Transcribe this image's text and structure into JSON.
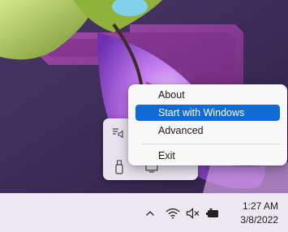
{
  "context_menu": {
    "items": [
      {
        "label": "About",
        "selected": false
      },
      {
        "label": "Start with Windows",
        "selected": true
      },
      {
        "label": "Advanced",
        "selected": false
      },
      {
        "label": "Exit",
        "selected": false
      }
    ]
  },
  "tray_overflow": {
    "icons": [
      "equalizer-volume-icon",
      "usb-drive-icon",
      "display-icon"
    ]
  },
  "taskbar": {
    "tray_icons": [
      "chevron-up-icon",
      "wifi-icon",
      "volume-muted-icon",
      "battery-charging-icon"
    ],
    "clock": {
      "time": "1:27 AM",
      "date": "3/8/2022"
    }
  },
  "colors": {
    "accent": "#0f6cd5",
    "taskbar": "#eee9f1",
    "menu": "#f9f9f9"
  }
}
